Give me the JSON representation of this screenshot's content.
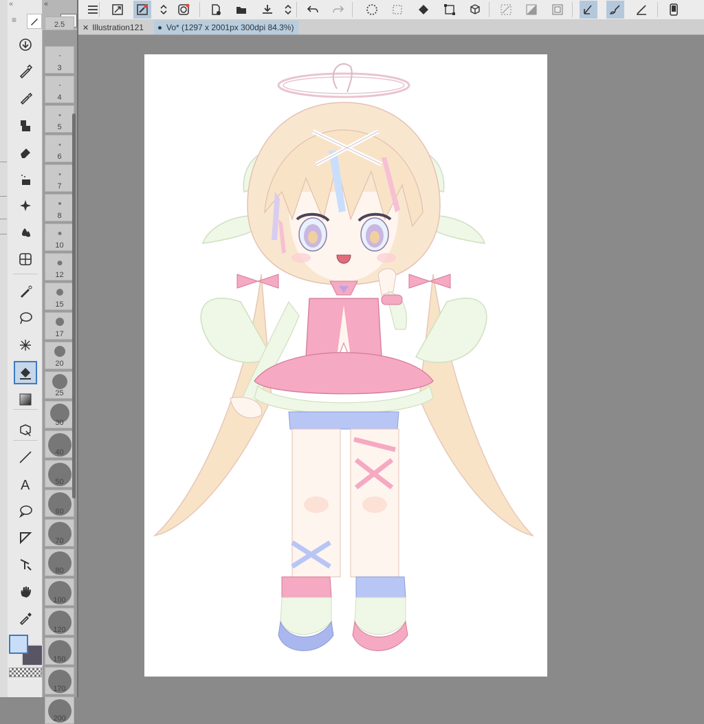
{
  "tabs": [
    {
      "label": "Illustration121",
      "close_icon": "close-icon"
    },
    {
      "label": "Vo* (1297 x 2001px 300dpi 84.3%)",
      "modified": true
    }
  ],
  "brush_sizes": [
    {
      "label": "2.5"
    },
    {
      "label": "3"
    },
    {
      "label": "4"
    },
    {
      "label": "5"
    },
    {
      "label": "6"
    },
    {
      "label": "7"
    },
    {
      "label": "8"
    },
    {
      "label": "10"
    },
    {
      "label": "12"
    },
    {
      "label": "15"
    },
    {
      "label": "17"
    },
    {
      "label": "20"
    },
    {
      "label": "25"
    },
    {
      "label": "30"
    },
    {
      "label": "40"
    },
    {
      "label": "50"
    },
    {
      "label": "60"
    },
    {
      "label": "70"
    },
    {
      "label": "80"
    },
    {
      "label": "100"
    },
    {
      "label": "120"
    },
    {
      "label": "150"
    },
    {
      "label": "170"
    },
    {
      "label": "200"
    }
  ],
  "colors": {
    "main_color": "#c9ddf6",
    "sub_color": "#5a5565",
    "accent": "#3d7bc2"
  },
  "toolbar": {
    "icons": [
      "menu-icon",
      "fit-view-icon",
      "pen-settings-icon",
      "up-down-icon",
      "layer-icon",
      "new-file-icon",
      "open-folder-icon",
      "save-icon",
      "up-down-icon",
      "undo-icon",
      "redo-icon",
      "loading-icon",
      "selection-icon",
      "fill-icon",
      "transform-icon",
      "3d-icon",
      "select-all-icon",
      "clear-icon",
      "frame-icon",
      "pen-icon",
      "brush-icon",
      "ruler-pen-icon",
      "device-icon"
    ]
  },
  "tools": [
    "download-icon",
    "pen-icon",
    "pencil-icon",
    "brush-icon",
    "eraser-icon",
    "airbrush-icon",
    "sparkle-icon",
    "blend-icon",
    "grid-icon",
    "vector-pen-icon",
    "lasso-icon",
    "magic-wand-icon",
    "fill-icon",
    "gradient-icon",
    "object-icon",
    "line-icon",
    "text-icon",
    "speech-bubble-icon",
    "ruler-icon",
    "correct-line-icon",
    "hand-icon",
    "eyedropper-icon"
  ],
  "active_tool": "fill-icon"
}
